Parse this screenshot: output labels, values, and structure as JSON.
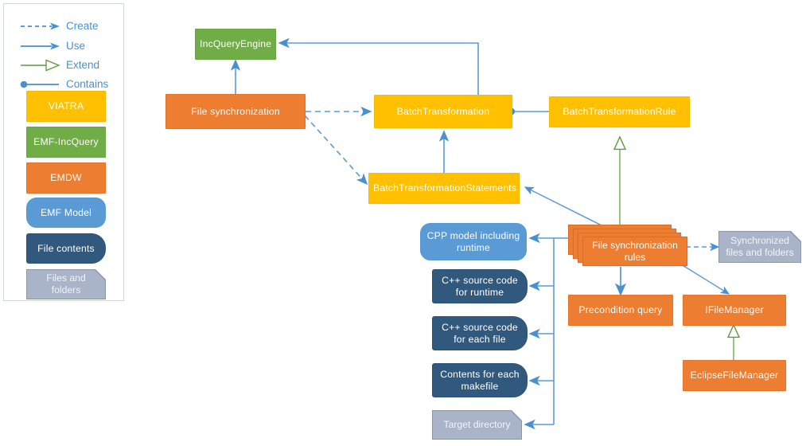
{
  "legend": {
    "entries": [
      {
        "id": "create",
        "label": "Create",
        "style": "dashed-arrow",
        "color": "#5B9BD5"
      },
      {
        "id": "use",
        "label": "Use",
        "style": "solid-arrow",
        "color": "#5B9BD5"
      },
      {
        "id": "extend",
        "label": "Extend",
        "style": "hollow-triangle-arrow",
        "color": "#70AD47"
      },
      {
        "id": "contains",
        "label": "Contains",
        "style": "filled-circle-line",
        "color": "#5B9BD5"
      }
    ],
    "swatches": [
      {
        "id": "viatra",
        "label": "VIATRA",
        "color": "#FFC000",
        "shape": "rectangle"
      },
      {
        "id": "emf-incquery",
        "label": "EMF-IncQuery",
        "color": "#70AD47",
        "shape": "rectangle"
      },
      {
        "id": "emdw",
        "label": "EMDW",
        "color": "#ED7D31",
        "shape": "rectangle"
      },
      {
        "id": "emf-model",
        "label": "EMF Model",
        "color": "#5B9BD5",
        "shape": "rounded"
      },
      {
        "id": "file-contents",
        "label": "File contents",
        "color": "#31597E",
        "shape": "document"
      },
      {
        "id": "files-and-folders",
        "label": "Files and folders",
        "color": "#A9B4C8",
        "shape": "folder"
      }
    ]
  },
  "nodes": {
    "inc_query_engine": "IncQueryEngine",
    "file_synchronization": "File synchronization",
    "batch_transformation": "BatchTransformation",
    "batch_transformation_rule": "BatchTransformationRule",
    "batch_transformation_statements": "BatchTransformationStatements",
    "file_synchronization_rules": "File synchronization rules",
    "synchronized_files_and_folders": "Synchronized files and folders",
    "precondition_query": "Precondition query",
    "ifilemanager": "IFileManager",
    "eclipse_file_manager": "EclipseFileManager",
    "cpp_model_including_runtime": "CPP model including runtime",
    "cpp_source_code_for_runtime": "C++ source code for runtime",
    "cpp_source_code_for_each_file": "C++ source code for each file",
    "contents_for_each_makefile": "Contents for each makefile",
    "target_directory": "Target directory"
  },
  "colors": {
    "viatra_yellow": "#FFC000",
    "incquery_green": "#70AD47",
    "emdw_orange": "#ED7D31",
    "emf_model_blue": "#5B9BD5",
    "file_contents_navy": "#31597E",
    "files_folders_gray": "#A9B4C8",
    "edge_blue": "#5B9BD5",
    "edge_green": "#70AD47"
  }
}
